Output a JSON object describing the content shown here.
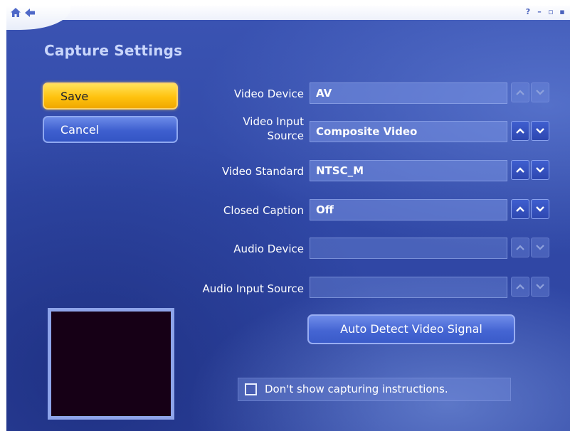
{
  "window": {
    "nav_icons": [
      "home-icon",
      "back-arrow-icon"
    ],
    "controls": [
      "help-icon",
      "minimize-icon",
      "restore-icon",
      "close-icon"
    ],
    "control_glyphs": {
      "help": "?",
      "minimize": "–",
      "restore": "▫",
      "close": "▪"
    }
  },
  "page": {
    "title": "Capture Settings"
  },
  "actions": {
    "save_label": "Save",
    "cancel_label": "Cancel"
  },
  "settings": {
    "video_device": {
      "label": "Video Device",
      "value": "AV"
    },
    "video_input_source": {
      "label_line1": "Video Input",
      "label_line2": "Source",
      "value": "Composite Video"
    },
    "video_standard": {
      "label": "Video Standard",
      "value": "NTSC_M"
    },
    "closed_caption": {
      "label": "Closed Caption",
      "value": "Off"
    },
    "audio_device": {
      "label": "Audio Device",
      "value": ""
    },
    "audio_input_source": {
      "label": "Audio Input Source",
      "value": ""
    }
  },
  "auto_detect": {
    "label": "Auto Detect Video Signal"
  },
  "instructions_checkbox": {
    "label": "Don't show capturing instructions.",
    "checked": false
  },
  "colors": {
    "background": "#3048a6",
    "accent_button": "#ffc20e",
    "button_blue": "#4565d3",
    "title_text": "#c9d6fb",
    "preview": "#160016"
  }
}
